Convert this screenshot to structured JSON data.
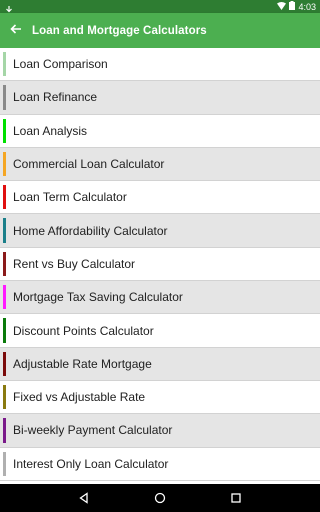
{
  "status_bar": {
    "time": "4:03",
    "icons": [
      "download-icon",
      "wifi-icon",
      "battery-icon"
    ]
  },
  "app_bar": {
    "title": "Loan and Mortgage Calculators",
    "back_icon": "arrow-back-icon",
    "background": "#4caf50",
    "status_color": "#2e7d32"
  },
  "items": [
    {
      "label": "Loan Comparison",
      "color": "#a5d6a7"
    },
    {
      "label": "Loan Refinance",
      "color": "#8a8a8a"
    },
    {
      "label": "Loan Analysis",
      "color": "#00e000"
    },
    {
      "label": "Commercial Loan Calculator",
      "color": "#f5a623"
    },
    {
      "label": "Loan Term Calculator",
      "color": "#e01010"
    },
    {
      "label": "Home Affordability Calculator",
      "color": "#1b7f8a"
    },
    {
      "label": "Rent vs Buy Calculator",
      "color": "#8b1a1a"
    },
    {
      "label": "Mortgage Tax Saving Calculator",
      "color": "#ff1aff"
    },
    {
      "label": "Discount Points Calculator",
      "color": "#0a7a0a"
    },
    {
      "label": "Adjustable Rate Mortgage",
      "color": "#7a0a0a"
    },
    {
      "label": "Fixed vs Adjustable Rate",
      "color": "#8a7a10"
    },
    {
      "label": "Bi-weekly Payment Calculator",
      "color": "#7a1a8a"
    },
    {
      "label": "Interest Only Loan Calculator",
      "color": "#b0b0b0"
    }
  ],
  "nav_bar": {
    "icons": [
      "back-triangle-icon",
      "home-circle-icon",
      "recents-square-icon"
    ]
  }
}
